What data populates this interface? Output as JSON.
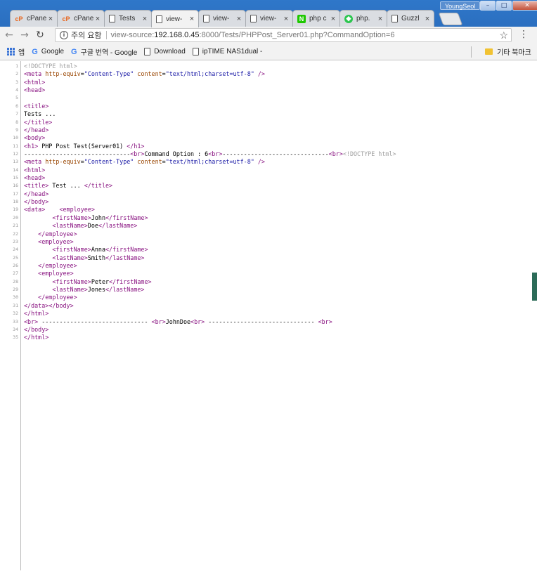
{
  "window": {
    "user": "YoungSeol",
    "minimize": "–",
    "maximize": "□",
    "close": "✕"
  },
  "tabs": [
    {
      "label": "cPanel",
      "icon": "cpanel-icon"
    },
    {
      "label": "cPanel",
      "icon": "cpanel-icon"
    },
    {
      "label": "Tests",
      "icon": "page-icon"
    },
    {
      "label": "view-",
      "icon": "page-icon",
      "active": true
    },
    {
      "label": "view-",
      "icon": "page-icon"
    },
    {
      "label": "view-",
      "icon": "page-icon"
    },
    {
      "label": "php c",
      "icon": "naver-icon"
    },
    {
      "label": "php.",
      "icon": "green-icon"
    },
    {
      "label": "Guzzl",
      "icon": "page-icon"
    }
  ],
  "toolbar": {
    "security_label": "주의 요함",
    "url_prefix": "view-source:",
    "url_host": "192.168.0.45",
    "url_path": ":8000/Tests/PHPPost_Server01.php?CommandOption=6"
  },
  "bookmarks": {
    "apps": "앱",
    "items": [
      "Google",
      "구글 번역 - Google",
      "Download",
      "ipTIME NAS1dual - "
    ],
    "other": "기타 북마크"
  },
  "source": {
    "numbers": [
      "1",
      "2",
      "3",
      "4",
      "5",
      "6",
      "7",
      "8",
      "9",
      "10",
      "11",
      "12",
      "13",
      "14",
      "15",
      "16",
      "17",
      "18",
      "19",
      "20",
      "21",
      "22",
      "23",
      "24",
      "25",
      "26",
      "27",
      "28",
      "29",
      "30",
      "31",
      "32",
      "33",
      "34",
      "35"
    ],
    "lines": [
      "<!DOCTYPE html>",
      "<meta http-equiv=\"Content-Type\" content=\"text/html;charset=utf-8\" />",
      "<html>",
      "<head>",
      "",
      "<title>",
      "Tests ...",
      "</title>",
      "</head>",
      "<body>",
      "<h1> PHP Post Test(Server01) </h1>",
      "------------------------------<br>Command Option : 6<br>------------------------------<br><!DOCTYPE html>",
      "<meta http-equiv=\"Content-Type\" content=\"text/html;charset=utf-8\" />",
      "<html>",
      "<head>",
      "<title> Test ... </title>",
      "</head>",
      "</body>",
      "<data>    <employee>",
      "        <firstName>John</firstName>",
      "        <lastName>Doe</lastName>",
      "    </employee>",
      "    <employee>",
      "        <firstName>Anna</firstName>",
      "        <lastName>Smith</lastName>",
      "    </employee>",
      "    <employee>",
      "        <firstName>Peter</firstName>",
      "        <lastName>Jones</lastName>",
      "    </employee>",
      "</data></body>",
      "</html>",
      "<br> ------------------------------ <br>JohnDoe<br> ------------------------------ <br>",
      "</body>",
      "</html>"
    ]
  }
}
